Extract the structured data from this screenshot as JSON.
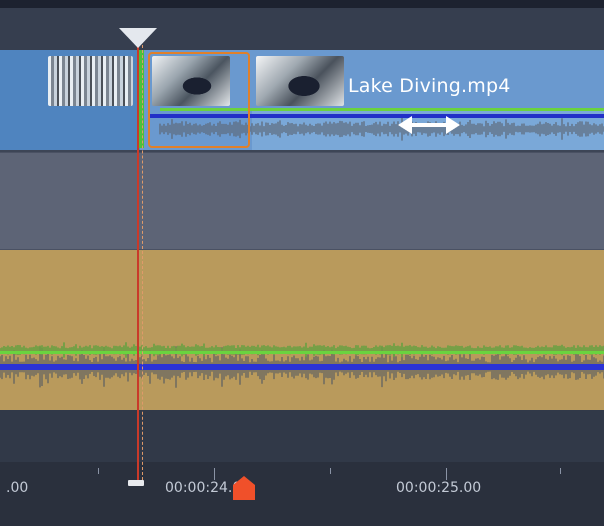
{
  "clip": {
    "title": "Lake Diving.mp4"
  },
  "ruler": {
    "labels": [
      ".00",
      "00:00:24.00",
      "00:00:25.00"
    ]
  },
  "icons": {
    "playhead": "playhead-triangle-icon",
    "resize": "double-arrow-icon",
    "current_time": "pentagon-marker-icon"
  },
  "colors": {
    "video_clip": "#6a99cf",
    "audio_track": "#b99a5c",
    "volume_line": "#6ad33f",
    "playhead": "#c93a2a",
    "selection_outline": "#e0802a",
    "current_time_marker": "#f0502a"
  }
}
